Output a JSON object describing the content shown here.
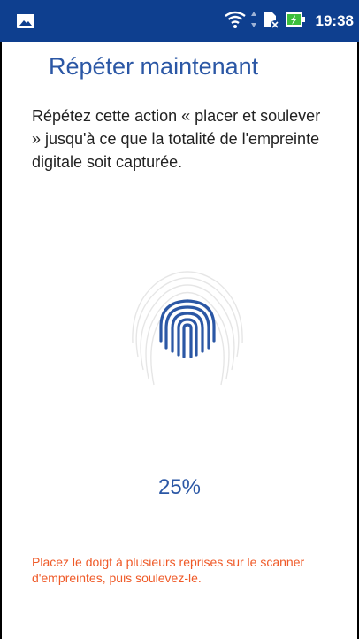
{
  "status_bar": {
    "time": "19:38",
    "notification_icon": "image-icon",
    "wifi_icon": "wifi-icon",
    "sim_icon": "sim-icon",
    "battery_icon": "battery-charging-icon"
  },
  "screen": {
    "title": "Répéter maintenant",
    "description": "Répétez cette action « placer et soulever » jusqu'à ce que la totalité de l'empreinte digitale soit capturée.",
    "progress_text": "25%",
    "progress_value": 0.25,
    "hint": "Placez le doigt à plusieurs reprises sur le scanner d'empreintes, puis soulevez-le.",
    "fingerprint_icon": "fingerprint-icon"
  },
  "colors": {
    "status_bar": "#0e3f8f",
    "accent": "#2b57a5",
    "hint": "#ef5a28"
  }
}
